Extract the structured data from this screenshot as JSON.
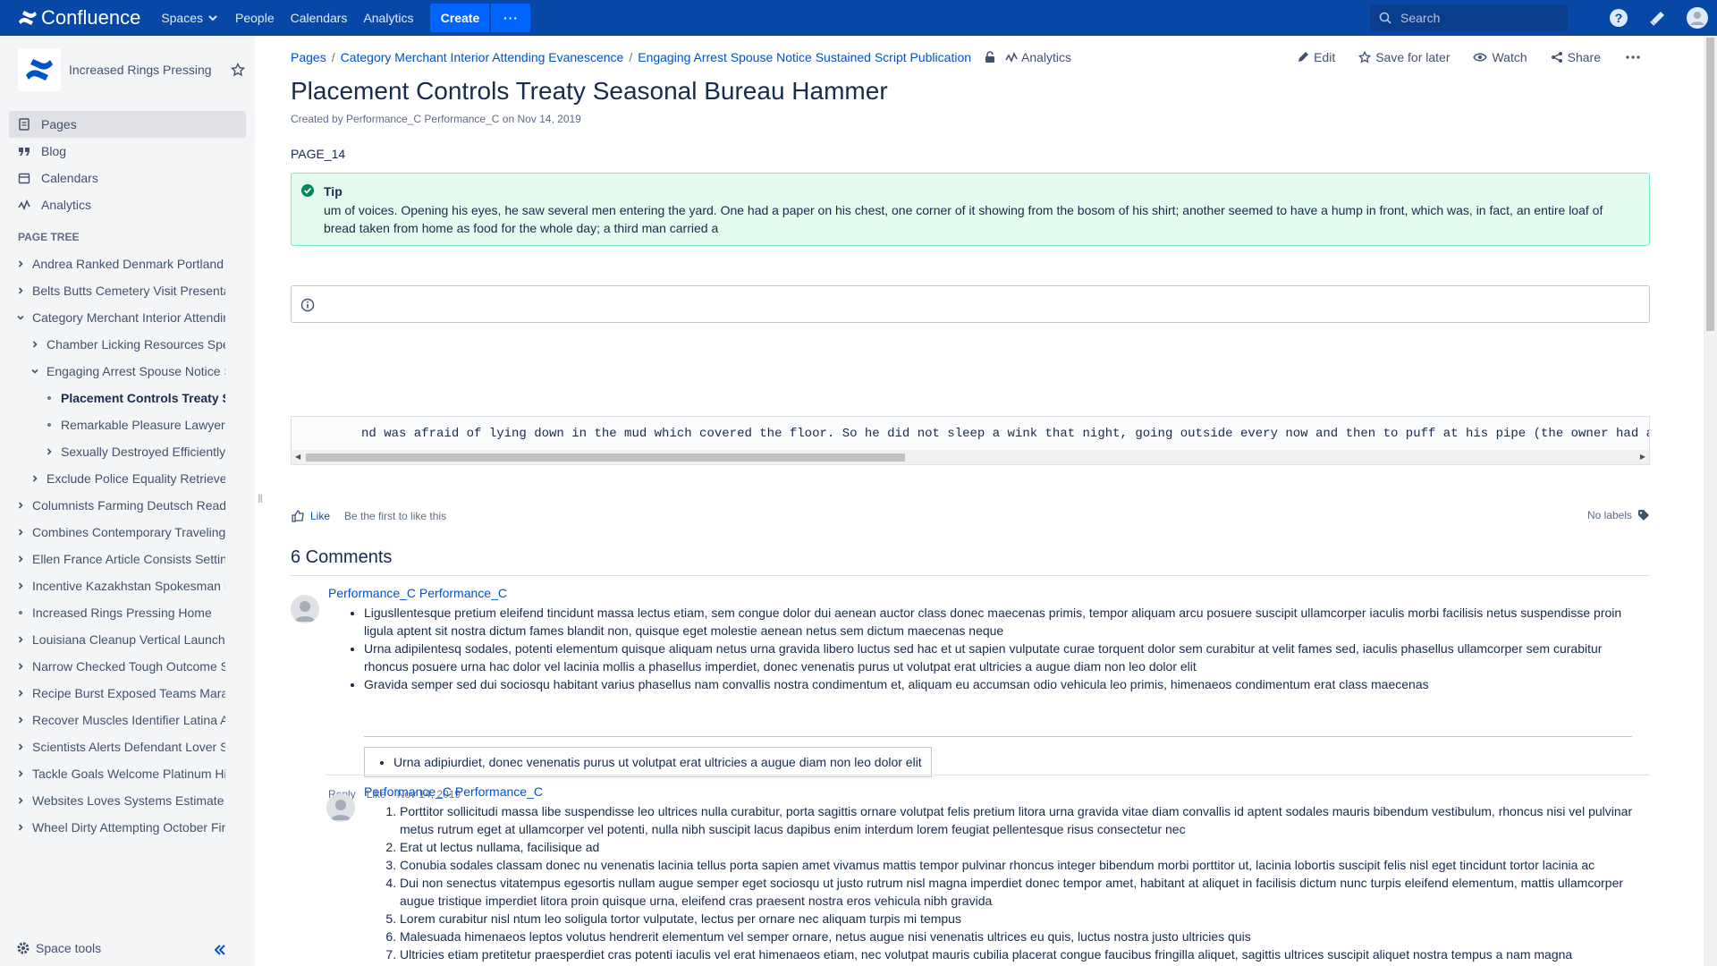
{
  "topbar": {
    "brand": "Confluence",
    "nav": [
      "Spaces",
      "People",
      "Calendars",
      "Analytics"
    ],
    "create_label": "Create",
    "more_label": "···",
    "search_placeholder": "Search"
  },
  "sidebar": {
    "space_name": "Increased Rings Pressing",
    "nav": [
      {
        "label": "Pages",
        "icon": "pages-icon"
      },
      {
        "label": "Blog",
        "icon": "quote-icon"
      },
      {
        "label": "Calendars",
        "icon": "calendar-icon"
      },
      {
        "label": "Analytics",
        "icon": "analytics-icon"
      }
    ],
    "page_tree_title": "PAGE TREE",
    "tree": [
      {
        "label": "Andrea Ranked Denmark Portland Way",
        "level": 0,
        "state": "collapsed"
      },
      {
        "label": "Belts Butts Cemetery Visit Presentation",
        "level": 0,
        "state": "collapsed"
      },
      {
        "label": "Category Merchant Interior Attending Evanescence",
        "level": 0,
        "state": "expanded"
      },
      {
        "label": "Chamber Licking Resources Speaking",
        "level": 1,
        "state": "collapsed"
      },
      {
        "label": "Engaging Arrest Spouse Notice Sustained",
        "level": 1,
        "state": "expanded"
      },
      {
        "label": "Placement Controls Treaty Seasonal",
        "level": 2,
        "state": "leaf",
        "current": true
      },
      {
        "label": "Remarkable Pleasure Lawyers",
        "level": 2,
        "state": "leaf"
      },
      {
        "label": "Sexually Destroyed Efficiently S",
        "level": 2,
        "state": "collapsed"
      },
      {
        "label": "Exclude Police Equality Retrieve Gallery",
        "level": 1,
        "state": "collapsed"
      },
      {
        "label": "Columnists Farming Deutsch Ready",
        "level": 0,
        "state": "collapsed"
      },
      {
        "label": "Combines Contemporary Traveling Info",
        "level": 0,
        "state": "collapsed"
      },
      {
        "label": "Ellen France Article Consists Settings",
        "level": 0,
        "state": "collapsed"
      },
      {
        "label": "Incentive Kazakhstan Spokesman Further",
        "level": 0,
        "state": "collapsed"
      },
      {
        "label": "Increased Rings Pressing Home",
        "level": 0,
        "state": "leaf"
      },
      {
        "label": "Louisiana Cleanup Vertical Launch Argue",
        "level": 0,
        "state": "collapsed"
      },
      {
        "label": "Narrow Checked Tough Outcome Stars",
        "level": 0,
        "state": "collapsed"
      },
      {
        "label": "Recipe Burst Exposed Teams Marathon",
        "level": 0,
        "state": "collapsed"
      },
      {
        "label": "Recover Muscles Identifier Latina Accept",
        "level": 0,
        "state": "collapsed"
      },
      {
        "label": "Scientists Alerts Defendant Lover Slope",
        "level": 0,
        "state": "collapsed"
      },
      {
        "label": "Tackle Goals Welcome Platinum Hints",
        "level": 0,
        "state": "collapsed"
      },
      {
        "label": "Websites Loves Systems Estimate Issues",
        "level": 0,
        "state": "collapsed"
      },
      {
        "label": "Wheel Dirty Attempting October Finite",
        "level": 0,
        "state": "collapsed"
      }
    ],
    "space_tools": "Space tools"
  },
  "page": {
    "breadcrumbs": [
      "Pages",
      "Category Merchant Interior Attending Evanescence",
      "Engaging Arrest Spouse Notice Sustained Script Publication"
    ],
    "analytics_label": "Analytics",
    "actions": {
      "edit": "Edit",
      "save": "Save for later",
      "watch": "Watch",
      "share": "Share"
    },
    "title": "Placement Controls Treaty Seasonal Bureau Hammer",
    "byline": "Created by Performance_C Performance_C on Nov 14, 2019",
    "page_id": "PAGE_14",
    "tip_title": "Tip",
    "tip_body": "um of voices. Opening his eyes, he saw several men entering the yard. One had a paper on his chest, one corner of it showing from the bosom of his shirt; another seemed to have a hump in front, which was, in fact, an entire loaf of bread taken from home as food for the whole day; a third man carried a",
    "code_text": "nd was afraid of lying down in the mud which covered the floor. So he did not sleep a wink that night, going outside every now and then to puff at his pipe (the owner had a",
    "like_label": "Like",
    "first_like": "Be the first to like this",
    "no_labels": "No labels",
    "comments_title": "6 Comments"
  },
  "comments": [
    {
      "author": "Performance_C Performance_C",
      "items": [
        "Ligusllentesque pretium eleifend tincidunt massa lectus etiam, sem congue dolor dui aenean auctor class donec maecenas primis, tempor aliquam arcu posuere suscipit ullamcorper iaculis morbi facilisis netus suspendisse proin ligula aptent sit nostra dictum fames blandit non, quisque eget molestie aenean netus sem dictum maecenas neque",
        "Urna adipilentesq sodales, potenti elementum quisque aliquam netus urna gravida libero luctus sed hac et ut sapien vulputate curae torquent dolor sem curabitur at velit fames sed, iaculis phasellus ullamcorper sem curabitur rhoncus posuere urna hac dolor vel lacinia mollis a phasellus imperdiet, donec venenatis purus ut volutpat erat ultricies a augue diam non leo dolor elit",
        "Gravida semper sed dui sociosqu habitant varius phasellus nam convallis nostra condimentum et, aliquam eu accumsan odio vehicula leo primis, himenaeos condimentum erat class maecenas"
      ],
      "nested": "Urna adipiurdiet, donec venenatis purus ut volutpat erat ultricies a augue diam non leo dolor elit",
      "reply": "Reply",
      "like": "Like",
      "date": "Nov 14, 2019"
    },
    {
      "author": "Performance_C Performance_C",
      "items": [
        "Porttitor sollicitudi massa libe suspendisse leo ultrices nulla curabitur, porta sagittis ornare volutpat felis pretium litora urna gravida vitae diam convallis id aptent sodales mauris bibendum vestibulum, rhoncus nisi vel pulvinar metus rutrum eget at ullamcorper vel potenti, nulla nibh suscipit lacus dapibus enim interdum lorem feugiat pellentesque risus consectetur nec",
        "Erat ut lectus nullama, facilisique ad",
        "Conubia sodales classam donec nu venenatis lacinia tellus porta sapien amet vivamus mattis tempor pulvinar rhoncus integer bibendum morbi porttitor ut, lacinia lobortis suscipit felis nisl eget tincidunt tortor lacinia ac",
        "Dui non senectus vitatempus egesortis nullam augue semper eget sociosqu ut justo rutrum nisl magna imperdiet donec tempor amet, habitant at aliquet in facilisis dictum nunc turpis eleifend elementum, mattis ullamcorper augue tristique imperdiet litora proin quisque urna, eleifend cras praesent nostra eros vehicula nibh gravida",
        "Lorem curabitur nisl ntum leo soligula tortor vulputate, lectus per ornare nec aliquam turpis mi tempus",
        "Malesuada himenaeos leptos volutus hendrerit elementum vel semper ornare, netus augue nisi venenatis ultrices eu quis, luctus nostra justo ultricies quis",
        "Ultricies etiam pretitetur praesperdiet cras potenti iaculis vel erat himenaeos etiam, nec volutpat mauris cubilia placerat congue faucibus fringilla aliquet, sagittis ultrices suscipit aliquet nostra tempus a nam magna"
      ]
    }
  ],
  "colors": {
    "topbar": "#0747a6",
    "link": "#0052cc",
    "tip_bg": "#e3fcef",
    "tip_border": "#79f2c0",
    "sidebar": "#f4f5f7"
  }
}
